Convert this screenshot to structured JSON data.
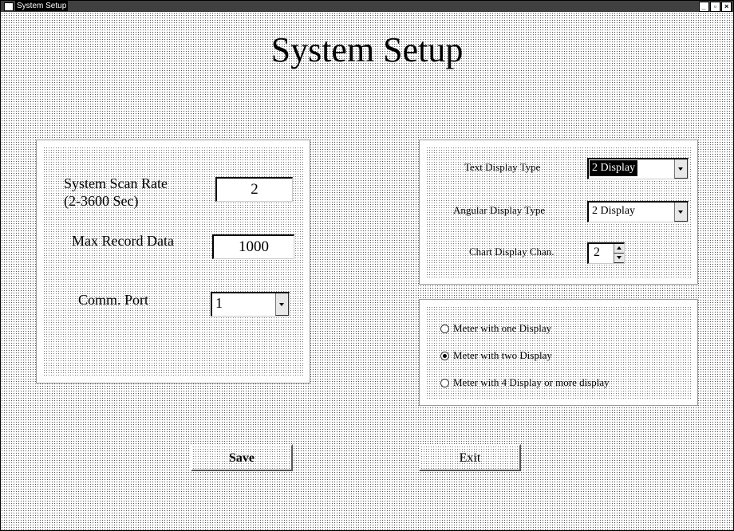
{
  "window": {
    "title": "System Setup",
    "controls": [
      "minimize-icon",
      "maximize-icon",
      "close-icon"
    ]
  },
  "heading": "System Setup",
  "left_panel": {
    "scan_rate_label_line1": "System Scan Rate",
    "scan_rate_label_line2": "(2-3600  Sec)",
    "scan_rate_value": "2",
    "max_record_label": "Max Record Data",
    "max_record_value": "1000",
    "comm_port_label": "Comm. Port",
    "comm_port_value": "1"
  },
  "display_panel": {
    "text_display_label": "Text Display Type",
    "text_display_value": "2 Display",
    "angular_display_label": "Angular Display Type",
    "angular_display_value": "2 Display",
    "chart_display_label": "Chart Display Chan.",
    "chart_display_value": "2"
  },
  "meter_panel": {
    "options": [
      {
        "label": "Meter with one Display",
        "selected": false
      },
      {
        "label": "Meter with two Display",
        "selected": true
      },
      {
        "label": "Meter with 4 Display or more display",
        "selected": false
      }
    ]
  },
  "buttons": {
    "save_label": "Save",
    "exit_label": "Exit"
  }
}
